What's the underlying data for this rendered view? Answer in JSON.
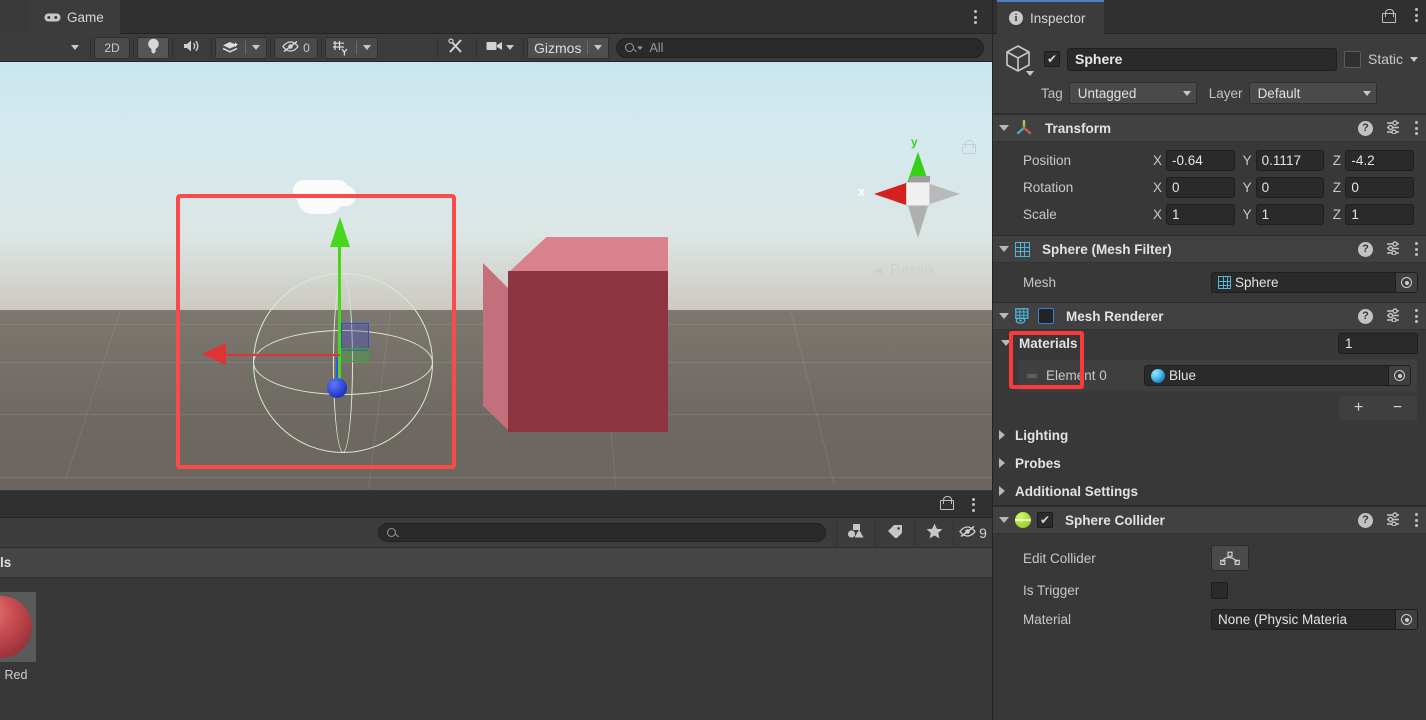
{
  "scene_panel": {
    "tabs": [
      {
        "label": "",
        "icon": "scene-icon",
        "active": false
      },
      {
        "label": "Game",
        "icon": "gamepad-icon",
        "active": true
      }
    ],
    "toolbar": {
      "draw_mode_caret": "▼",
      "mode_2d": "2D",
      "lighting_icon": "lightbulb-icon",
      "audio_icon": "speaker-icon",
      "effects_icon": "effects-icon",
      "effects_caret": "▼",
      "hidden_objects_icon": "eye-off-icon",
      "hidden_objects_count": "0",
      "grid_icon": "grid-snap-icon",
      "grid_caret": "▼",
      "tools_icon": "tools-icon",
      "camera_icon": "camera-icon",
      "camera_caret": "▼",
      "gizmos_label": "Gizmos",
      "gizmos_caret": "▼",
      "search_placeholder": "All",
      "search_value": "All"
    },
    "viewport": {
      "axis_gizmo": {
        "x_label": "x",
        "y_label": "y"
      },
      "projection_label": "Persp",
      "projection_arrow": "◄",
      "selected_object": "Sphere",
      "objects": [
        {
          "name": "Sphere",
          "type": "wireframe-sphere",
          "selected": true
        },
        {
          "name": "Cube",
          "type": "solid-cube",
          "color": "#8e3440"
        },
        {
          "name": "Cloud",
          "type": "cloud",
          "color": "#fbfbfb"
        }
      ],
      "gizmo": {
        "type": "move",
        "x_color": "#e03434",
        "y_color": "#49d71b",
        "z_color": "#2344e0"
      }
    }
  },
  "project_panel": {
    "search_placeholder": "",
    "search_value": "",
    "toolbar_buttons": [
      {
        "icon": "shapes-filter-icon",
        "label": ""
      },
      {
        "icon": "tag-icon",
        "label": ""
      },
      {
        "icon": "star-icon",
        "label": ""
      },
      {
        "icon": "eye-off-icon",
        "label": "9"
      }
    ],
    "breadcrumb": "ls",
    "assets": [
      {
        "name": "Red",
        "thumbnail": "material-sphere",
        "color": "#cf5257"
      }
    ]
  },
  "inspector": {
    "tab_label": "Inspector",
    "tab_icon": "info-icon",
    "lock_icon": "lock-open-icon",
    "kebab_icon": "kebab-menu-icon",
    "game_object": {
      "icon": "cube-icon",
      "enabled": true,
      "name": "Sphere",
      "static_checked": false,
      "static_label": "Static",
      "static_caret": "▼",
      "tag_label": "Tag",
      "tag_value": "Untagged",
      "layer_label": "Layer",
      "layer_value": "Default"
    },
    "components": [
      {
        "id": "transform",
        "title": "Transform",
        "icon": "transform-axis-icon",
        "expanded": true,
        "rows": [
          {
            "label": "Position",
            "axes": [
              "X",
              "Y",
              "Z"
            ],
            "values": [
              "-0.64",
              "0.1117",
              "-4.2"
            ]
          },
          {
            "label": "Rotation",
            "axes": [
              "X",
              "Y",
              "Z"
            ],
            "values": [
              "0",
              "0",
              "0"
            ]
          },
          {
            "label": "Scale",
            "axes": [
              "X",
              "Y",
              "Z"
            ],
            "values": [
              "1",
              "1",
              "1"
            ]
          }
        ]
      },
      {
        "id": "mesh-filter",
        "title": "Sphere (Mesh Filter)",
        "icon": "mesh-filter-icon",
        "expanded": true,
        "mesh_label": "Mesh",
        "mesh_value": "Sphere"
      },
      {
        "id": "mesh-renderer",
        "title": "Mesh Renderer",
        "icon": "mesh-renderer-icon",
        "expanded": true,
        "enabled": false,
        "highlighted": true,
        "materials": {
          "title": "Materials",
          "count": "1",
          "element_label": "Element 0",
          "element_value": "Blue",
          "add_label": "+",
          "remove_label": "−"
        },
        "foldouts": [
          {
            "label": "Lighting",
            "expanded": false
          },
          {
            "label": "Probes",
            "expanded": false
          },
          {
            "label": "Additional Settings",
            "expanded": false
          }
        ]
      },
      {
        "id": "sphere-collider",
        "title": "Sphere Collider",
        "icon": "sphere-collider-icon",
        "expanded": true,
        "enabled": true,
        "rows": [
          {
            "label": "Edit Collider",
            "type": "button",
            "icon": "edit-collider-icon"
          },
          {
            "label": "Is Trigger",
            "type": "checkbox",
            "checked": false
          },
          {
            "label": "Material",
            "type": "object",
            "value": "None (Physic Materia"
          }
        ]
      }
    ],
    "help_icon": "help-icon",
    "preset_icon": "preset-icon"
  },
  "colors": {
    "accent_blue": "#4e7fc4",
    "highlight_red": "#fb3b3b",
    "panel_bg": "#383838",
    "header_bg": "#414141",
    "gizmo_x": "#e03434",
    "gizmo_y": "#49d71b",
    "gizmo_z": "#2344e0"
  }
}
